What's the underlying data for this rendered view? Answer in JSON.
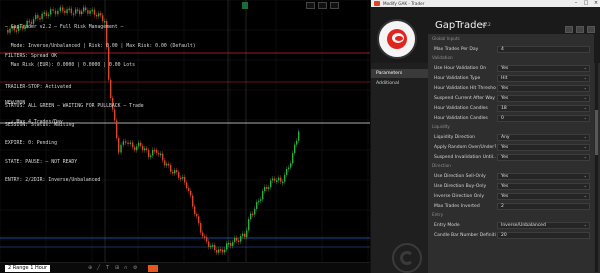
{
  "chart": {
    "price_flag": "",
    "controls": [
      "",
      "",
      ""
    ],
    "hud_top": [
      "— GapTrader v2.2 — Full Risk Management —",
      "  Mode: Inverse/Unbalanced | Risk: 0.00 | Max Risk: 0.00 (Default)",
      "  Max Risk (EUR): 0.0000 | 0.0000 | 0.00 Lots"
    ],
    "hud_mid": [
      "FILTERS: Spread OK",
      "",
      "TRAILER-STOP: Activated",
      "STATUS: ALL GREEN — WAITING FOR PULLBACK — Trade",
      "SESSION: Status: Waiting",
      "EXPIRE: 0: Pending",
      "STATE: PAUSE: — NOT READY",
      "ENTRY: 2/2DIR: Inverse/Unbalanced"
    ],
    "hud_bot": [
      "NEW/MON",
      "  ✓ Max 4 Trades/Day"
    ],
    "timeframe": "2 Range 1 Hour"
  },
  "settings": {
    "window_title": "Modify GAK - Trader",
    "app_name": "GapTrader",
    "app_version": "v2.2",
    "nav": [
      "Parameters",
      "Additional"
    ],
    "rows": [
      {
        "type": "cat",
        "text": "Global Inputs"
      },
      {
        "type": "row",
        "label": "Max Trades Per Day",
        "value": "4",
        "dd": false
      },
      {
        "type": "cat",
        "text": "Validation"
      },
      {
        "type": "row",
        "label": "Use Hour Validation On",
        "value": "Yes",
        "dd": true
      },
      {
        "type": "row",
        "label": "Hour Validation Type",
        "value": "Hit",
        "dd": true
      },
      {
        "type": "row",
        "label": "Hour Validation Hit Threshold",
        "value": "Yes",
        "dd": true
      },
      {
        "type": "row",
        "label": "Suspend Current After Way",
        "value": "Yes",
        "dd": true
      },
      {
        "type": "row",
        "label": "Hour Validation Candles",
        "value": "18",
        "dd": true
      },
      {
        "type": "row",
        "label": "Hour Validation Candles",
        "value": "0",
        "dd": true
      },
      {
        "type": "cat",
        "text": "Liquidity"
      },
      {
        "type": "row",
        "label": "Liquidity Direction",
        "value": "Any",
        "dd": true
      },
      {
        "type": "row",
        "label": "Apply Random Over/Under?",
        "value": "Yes",
        "dd": true
      },
      {
        "type": "row",
        "label": "Suspend Invalidation Until...",
        "value": "Yes",
        "dd": true
      },
      {
        "type": "cat",
        "text": "Direction"
      },
      {
        "type": "row",
        "label": "Use Direction Sell-Only",
        "value": "Yes",
        "dd": true
      },
      {
        "type": "row",
        "label": "Use Direction Buy-Only",
        "value": "Yes",
        "dd": true
      },
      {
        "type": "row",
        "label": "Inverse Direction Only",
        "value": "Yes",
        "dd": true
      },
      {
        "type": "row",
        "label": "Max Trades Inverted",
        "value": "2",
        "dd": false
      },
      {
        "type": "cat",
        "text": "Entry"
      },
      {
        "type": "row",
        "label": "Entry Mode",
        "value": "Inverse/Unbalanced",
        "dd": true
      },
      {
        "type": "row",
        "label": "Candle Bar Number Definition",
        "value": "20",
        "dd": false
      }
    ]
  },
  "colors": {
    "red_line": "#c0282b",
    "blue_line": "#2c60c7",
    "bull": "#2fae43",
    "bear": "#d8472e",
    "accent": "#e8561f"
  }
}
